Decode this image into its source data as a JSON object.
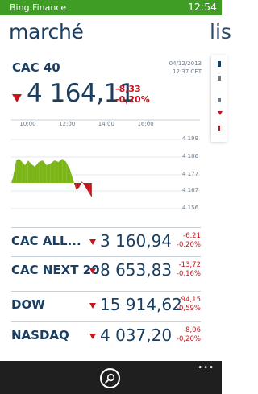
{
  "status": {
    "app_name": "Bing Finance",
    "time": "12:54",
    "bar_color": "#3f9d26"
  },
  "pivot": {
    "title": "marché",
    "next_title": "lis"
  },
  "featured": {
    "name": "CAC 40",
    "date": "04/12/2013",
    "time": "12:37 CET",
    "value": "4 164,11",
    "change_points": "-8,33",
    "change_percent": "-0,20%",
    "trend_icon": "down-arrow-icon"
  },
  "chart_data": {
    "type": "area",
    "x_tick_labels": [
      "10:00",
      "12:00",
      "14:00",
      "16:00"
    ],
    "y_tick_labels": [
      "4 199",
      "4 188",
      "4 177",
      "4 167",
      "4 156"
    ],
    "ylim": [
      4156,
      4199
    ],
    "xlim": [
      9.0,
      17.5
    ],
    "baseline": 4172,
    "grid": true,
    "series": [
      {
        "x": [
          9.0,
          9.1,
          9.25,
          9.4,
          9.55,
          9.7,
          9.85,
          10.0,
          10.2,
          10.4,
          10.6,
          10.8,
          11.0,
          11.2,
          11.4,
          11.6,
          11.8,
          12.0,
          12.2,
          12.3,
          12.45,
          12.6,
          12.75,
          12.9,
          13.0,
          13.1
        ],
        "values": [
          4172,
          4176,
          4186,
          4187,
          4185,
          4183,
          4186,
          4184,
          4182,
          4185,
          4186,
          4183,
          4184,
          4186,
          4185,
          4187,
          4185,
          4180,
          4172,
          4168,
          4169,
          4173,
          4170,
          4167,
          4165,
          4163
        ]
      }
    ],
    "colors": {
      "up": "#7cb518",
      "down": "#c4151c"
    }
  },
  "indices": [
    {
      "name": "CAC ALL...",
      "value": "3 160,94",
      "change_points": "-6,21",
      "change_percent": "-0,20%"
    },
    {
      "name": "CAC NEXT 20",
      "value": "8 653,83",
      "change_points": "-13,72",
      "change_percent": "-0,16%"
    },
    {
      "name": "DOW",
      "value": "15 914,62",
      "change_points": "-94,15",
      "change_percent": "-0,59%"
    },
    {
      "name": "NASDAQ",
      "value": "4 037,20",
      "change_points": "-8,06",
      "change_percent": "-0,20%"
    }
  ],
  "appbar": {
    "search_icon": "search-icon",
    "more_label": "•••"
  },
  "colors": {
    "accent": "#3f9d26",
    "text": "#1b3f62",
    "negative": "#c4151c"
  }
}
